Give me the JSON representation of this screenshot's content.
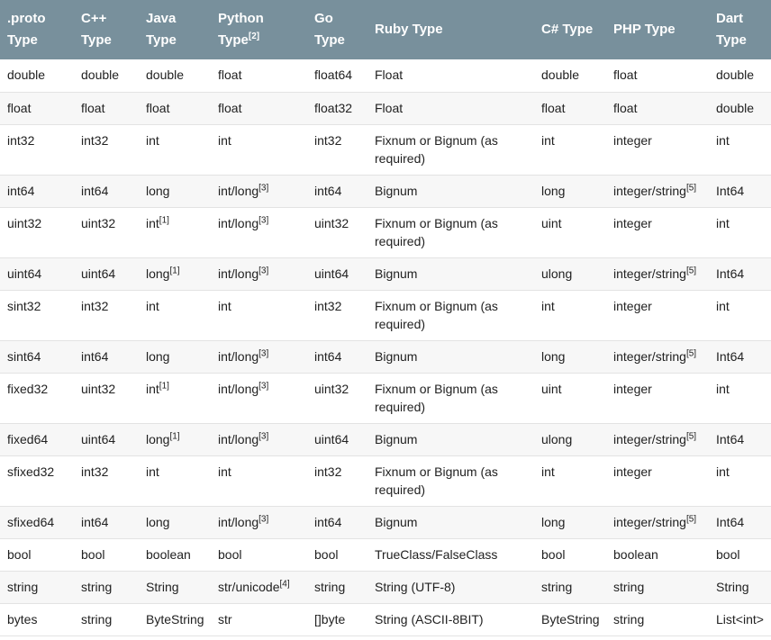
{
  "headers": [
    {
      "key": "proto",
      "lines": [
        ".proto",
        "Type"
      ]
    },
    {
      "key": "cpp",
      "lines": [
        "C++",
        "Type"
      ]
    },
    {
      "key": "java",
      "lines": [
        "Java",
        "Type"
      ]
    },
    {
      "key": "python",
      "lines": [
        "Python",
        "Type"
      ],
      "sup": "[2]"
    },
    {
      "key": "go",
      "lines": [
        "Go",
        "Type"
      ]
    },
    {
      "key": "ruby",
      "lines": [
        "Ruby Type"
      ]
    },
    {
      "key": "csharp",
      "lines": [
        "C# Type"
      ]
    },
    {
      "key": "php",
      "lines": [
        "PHP Type"
      ]
    },
    {
      "key": "dart",
      "lines": [
        "Dart",
        "Type"
      ]
    }
  ],
  "rows": [
    {
      "h": 1,
      "cells": [
        {
          "t": "double"
        },
        {
          "t": "double"
        },
        {
          "t": "double"
        },
        {
          "t": "float"
        },
        {
          "t": "float64"
        },
        {
          "t": "Float"
        },
        {
          "t": "double"
        },
        {
          "t": "float"
        },
        {
          "t": "double"
        }
      ]
    },
    {
      "h": 1,
      "cells": [
        {
          "t": "float"
        },
        {
          "t": "float"
        },
        {
          "t": "float"
        },
        {
          "t": "float"
        },
        {
          "t": "float32"
        },
        {
          "t": "Float"
        },
        {
          "t": "float"
        },
        {
          "t": "float"
        },
        {
          "t": "double"
        }
      ]
    },
    {
      "h": 2,
      "cells": [
        {
          "t": "int32"
        },
        {
          "t": "int32"
        },
        {
          "t": "int"
        },
        {
          "t": "int"
        },
        {
          "t": "int32"
        },
        {
          "t": "Fixnum or Bignum (as required)"
        },
        {
          "t": "int"
        },
        {
          "t": "integer"
        },
        {
          "t": "int"
        }
      ]
    },
    {
      "h": 1,
      "cells": [
        {
          "t": "int64"
        },
        {
          "t": "int64"
        },
        {
          "t": "long"
        },
        {
          "t": "int/long",
          "s": "[3]"
        },
        {
          "t": "int64"
        },
        {
          "t": "Bignum"
        },
        {
          "t": "long"
        },
        {
          "t": "integer/string",
          "s": "[5]"
        },
        {
          "t": "Int64"
        }
      ]
    },
    {
      "h": 2,
      "cells": [
        {
          "t": "uint32"
        },
        {
          "t": "uint32"
        },
        {
          "t": "int",
          "s": "[1]"
        },
        {
          "t": "int/long",
          "s": "[3]"
        },
        {
          "t": "uint32"
        },
        {
          "t": "Fixnum or Bignum (as required)"
        },
        {
          "t": "uint"
        },
        {
          "t": "integer"
        },
        {
          "t": "int"
        }
      ]
    },
    {
      "h": 1,
      "cells": [
        {
          "t": "uint64"
        },
        {
          "t": "uint64"
        },
        {
          "t": "long",
          "s": "[1]"
        },
        {
          "t": "int/long",
          "s": "[3]"
        },
        {
          "t": "uint64"
        },
        {
          "t": "Bignum"
        },
        {
          "t": "ulong"
        },
        {
          "t": "integer/string",
          "s": "[5]"
        },
        {
          "t": "Int64"
        }
      ]
    },
    {
      "h": 2,
      "cells": [
        {
          "t": "sint32"
        },
        {
          "t": "int32"
        },
        {
          "t": "int"
        },
        {
          "t": "int"
        },
        {
          "t": "int32"
        },
        {
          "t": "Fixnum or Bignum (as required)"
        },
        {
          "t": "int"
        },
        {
          "t": "integer"
        },
        {
          "t": "int"
        }
      ]
    },
    {
      "h": 1,
      "cells": [
        {
          "t": "sint64"
        },
        {
          "t": "int64"
        },
        {
          "t": "long"
        },
        {
          "t": "int/long",
          "s": "[3]"
        },
        {
          "t": "int64"
        },
        {
          "t": "Bignum"
        },
        {
          "t": "long"
        },
        {
          "t": "integer/string",
          "s": "[5]"
        },
        {
          "t": "Int64"
        }
      ]
    },
    {
      "h": 2,
      "cells": [
        {
          "t": "fixed32"
        },
        {
          "t": "uint32"
        },
        {
          "t": "int",
          "s": "[1]"
        },
        {
          "t": "int/long",
          "s": "[3]"
        },
        {
          "t": "uint32"
        },
        {
          "t": "Fixnum or Bignum (as required)"
        },
        {
          "t": "uint"
        },
        {
          "t": "integer"
        },
        {
          "t": "int"
        }
      ]
    },
    {
      "h": 1,
      "cells": [
        {
          "t": "fixed64"
        },
        {
          "t": "uint64"
        },
        {
          "t": "long",
          "s": "[1]"
        },
        {
          "t": "int/long",
          "s": "[3]"
        },
        {
          "t": "uint64"
        },
        {
          "t": "Bignum"
        },
        {
          "t": "ulong"
        },
        {
          "t": "integer/string",
          "s": "[5]"
        },
        {
          "t": "Int64"
        }
      ]
    },
    {
      "h": 2,
      "cells": [
        {
          "t": "sfixed32"
        },
        {
          "t": "int32"
        },
        {
          "t": "int"
        },
        {
          "t": "int"
        },
        {
          "t": "int32"
        },
        {
          "t": "Fixnum or Bignum (as required)"
        },
        {
          "t": "int"
        },
        {
          "t": "integer"
        },
        {
          "t": "int"
        }
      ]
    },
    {
      "h": 1,
      "cells": [
        {
          "t": "sfixed64"
        },
        {
          "t": "int64"
        },
        {
          "t": "long"
        },
        {
          "t": "int/long",
          "s": "[3]"
        },
        {
          "t": "int64"
        },
        {
          "t": "Bignum"
        },
        {
          "t": "long"
        },
        {
          "t": "integer/string",
          "s": "[5]"
        },
        {
          "t": "Int64"
        }
      ]
    },
    {
      "h": 1,
      "cells": [
        {
          "t": "bool"
        },
        {
          "t": "bool"
        },
        {
          "t": "boolean"
        },
        {
          "t": "bool"
        },
        {
          "t": "bool"
        },
        {
          "t": "TrueClass/FalseClass"
        },
        {
          "t": "bool"
        },
        {
          "t": "boolean"
        },
        {
          "t": "bool"
        }
      ]
    },
    {
      "h": 1,
      "cells": [
        {
          "t": "string"
        },
        {
          "t": "string"
        },
        {
          "t": "String"
        },
        {
          "t": "str/unicode",
          "s": "[4]"
        },
        {
          "t": "string"
        },
        {
          "t": "String (UTF-8)"
        },
        {
          "t": "string"
        },
        {
          "t": "string"
        },
        {
          "t": "String"
        }
      ]
    },
    {
      "h": 1,
      "cells": [
        {
          "t": "bytes"
        },
        {
          "t": "string"
        },
        {
          "t": "ByteString"
        },
        {
          "t": "str"
        },
        {
          "t": "[]byte"
        },
        {
          "t": "String (ASCII-8BIT)"
        },
        {
          "t": "ByteString"
        },
        {
          "t": "string"
        },
        {
          "t": "List<int>"
        }
      ]
    }
  ],
  "colors": {
    "header_bg": "#78909c",
    "header_text": "#ffffff",
    "row_alt": "#f7f7f7",
    "border": "#e3e3e3"
  }
}
